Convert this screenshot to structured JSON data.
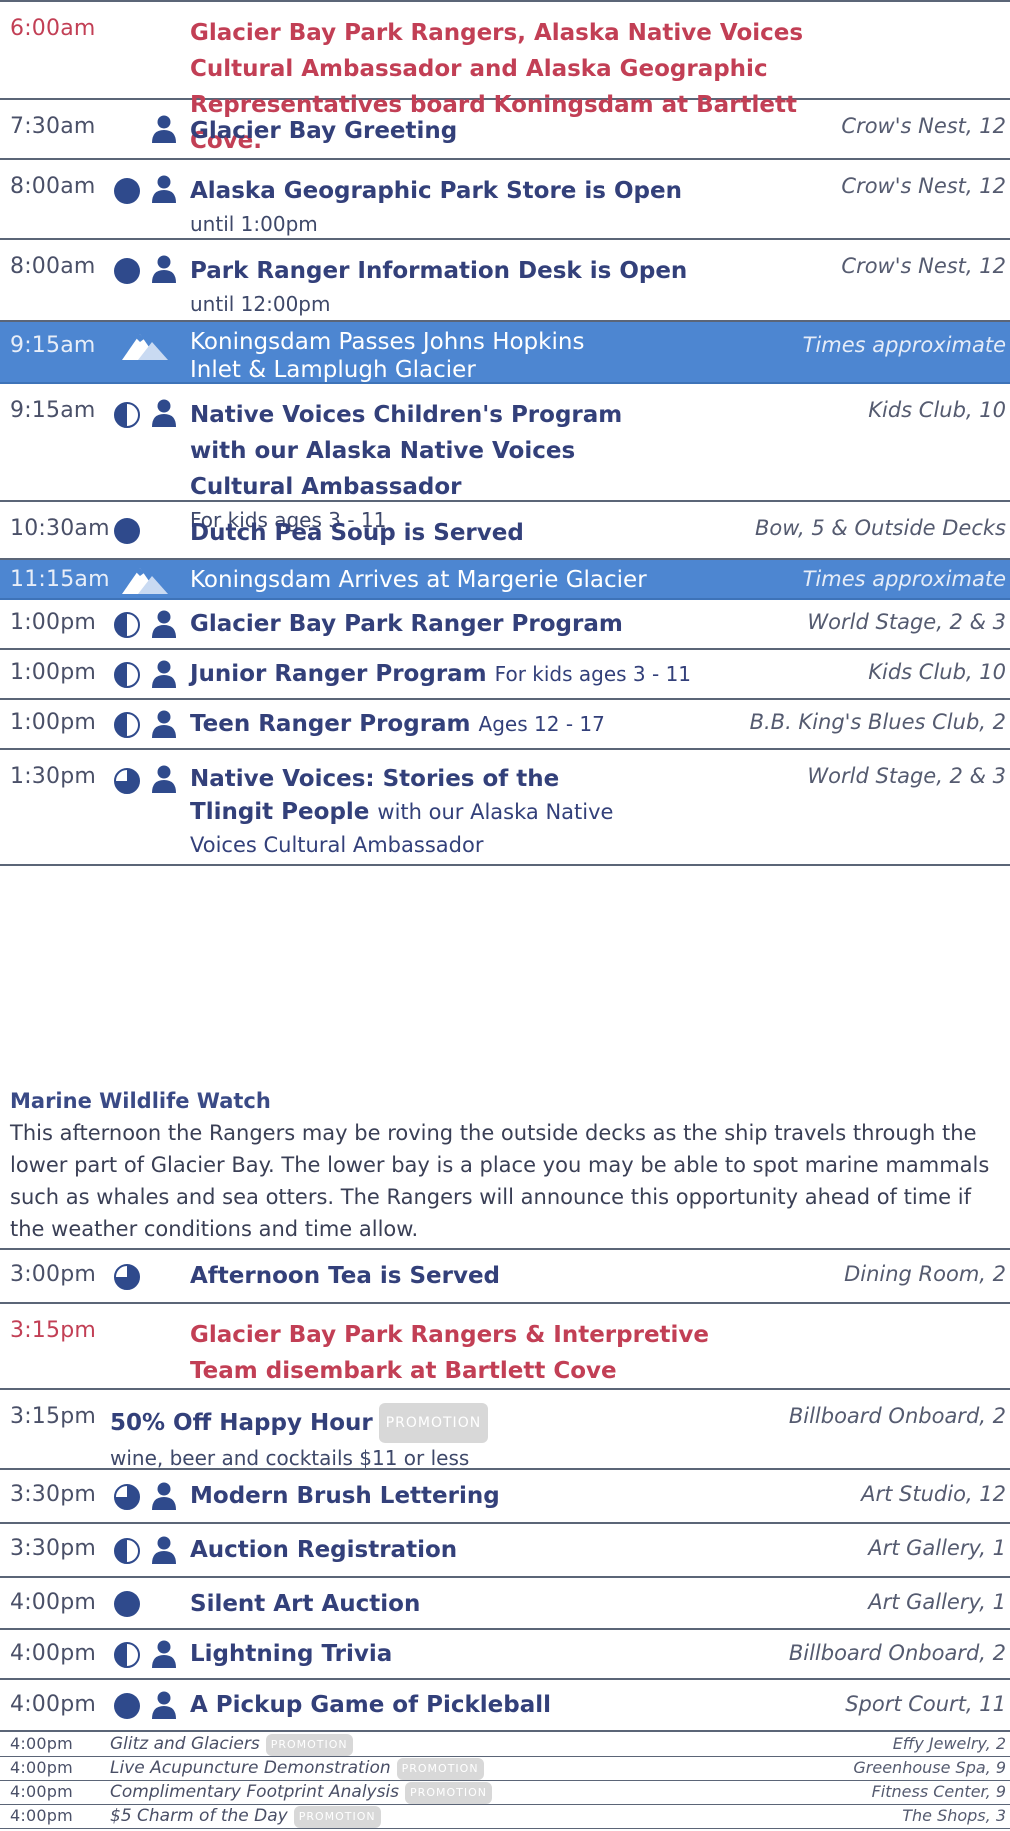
{
  "schedule": [
    {
      "time": "6:00am",
      "title": "Glacier Bay Park Rangers, Alaska Native Voices Cultural Ambassador and Alaska Geographic Representatives board Koningsdam at Bartlett Cove.",
      "location": ""
    },
    {
      "time": "7:30am",
      "title": "Glacier Bay Greeting",
      "location": "Crow's Nest, 12"
    },
    {
      "time": "8:00am",
      "title": "Alaska Geographic Park Store is Open",
      "sub": "until 1:00pm",
      "location": "Crow's Nest, 12"
    },
    {
      "time": "8:00am",
      "title": "Park Ranger Information Desk is Open",
      "sub": "until 12:00pm",
      "location": "Crow's Nest, 12"
    },
    {
      "time": "9:15am",
      "title": "Koningsdam Passes Johns Hopkins Inlet & Lamplugh Glacier",
      "location": "Times approximate"
    },
    {
      "time": "9:15am",
      "title": "Native Voices Children's Program with our Alaska Native Voices Cultural Ambassador",
      "sub": "For kids ages 3 - 11",
      "location": "Kids Club, 10"
    },
    {
      "time": "10:30am",
      "title": "Dutch Pea Soup is Served",
      "location": "Bow, 5 & Outside Decks"
    },
    {
      "time": "11:15am",
      "title": "Koningsdam Arrives at Margerie Glacier",
      "location": "Times approximate"
    },
    {
      "time": "1:00pm",
      "title": "Glacier Bay Park Ranger Program",
      "location": "World Stage, 2 & 3"
    },
    {
      "time": "1:00pm",
      "title": "Junior Ranger Program",
      "extra": "For kids ages 3 - 11",
      "location": "Kids Club, 10"
    },
    {
      "time": "1:00pm",
      "title": "Teen Ranger Program",
      "extra": "Ages 12 - 17",
      "location": "B.B. King's Blues Club, 2"
    },
    {
      "time": "1:30pm",
      "title": "Native Voices: Stories of the Tlingit People",
      "extra": "with our Alaska Native Voices Cultural Ambassador",
      "location": "World Stage, 2 & 3"
    },
    {
      "time": "3:00pm",
      "title": "Afternoon Tea is Served",
      "location": "Dining Room, 2"
    },
    {
      "time": "3:15pm",
      "title": "Glacier Bay Park Rangers & Interpretive Team disembark at Bartlett Cove",
      "location": ""
    },
    {
      "time": "3:15pm",
      "title": "50% Off Happy Hour",
      "badge": "PROMOTION",
      "sub": "wine, beer and cocktails $11 or less",
      "location": "Billboard Onboard, 2"
    },
    {
      "time": "3:30pm",
      "title": "Modern Brush Lettering",
      "location": "Art Studio, 12"
    },
    {
      "time": "3:30pm",
      "title": "Auction Registration",
      "location": "Art Gallery, 1"
    },
    {
      "time": "4:00pm",
      "title": "Silent Art Auction",
      "location": "Art Gallery, 1"
    },
    {
      "time": "4:00pm",
      "title": "Lightning Trivia",
      "location": "Billboard Onboard, 2"
    },
    {
      "time": "4:00pm",
      "title": "A Pickup Game of Pickleball",
      "location": "Sport Court, 11"
    },
    {
      "time": "4:00pm",
      "title": "Glitz and Glaciers",
      "badge": "PROMOTION",
      "location": "Effy Jewelry, 2"
    },
    {
      "time": "4:00pm",
      "title": "Live Acupuncture Demonstration",
      "badge": "PROMOTION",
      "location": "Greenhouse Spa, 9"
    },
    {
      "time": "4:00pm",
      "title": "Complimentary Footprint Analysis",
      "badge": "PROMOTION",
      "location": "Fitness Center, 9"
    },
    {
      "time": "4:00pm",
      "title": "$5 Charm of the Day",
      "badge": "PROMOTION",
      "location": "The Shops, 3"
    }
  ],
  "marine_watch": {
    "title": "Marine Wildlife Watch",
    "body": "This afternoon the Rangers may be roving the outside decks as the ship travels through the lower part of Glacier Bay. The lower bay is a place you may be able to spot marine mammals such as whales and sea otters. The Rangers will announce this opportunity ahead of time if the weather conditions and time allow."
  },
  "colors": {
    "band": "#4d86d1",
    "navy": "#2f4a8c",
    "red": "#c23f55",
    "text": "#33407a"
  },
  "icons": [
    "full-circle-icon",
    "half-circle-icon",
    "three-quarter-circle-icon",
    "person-icon",
    "mountain-icon"
  ]
}
